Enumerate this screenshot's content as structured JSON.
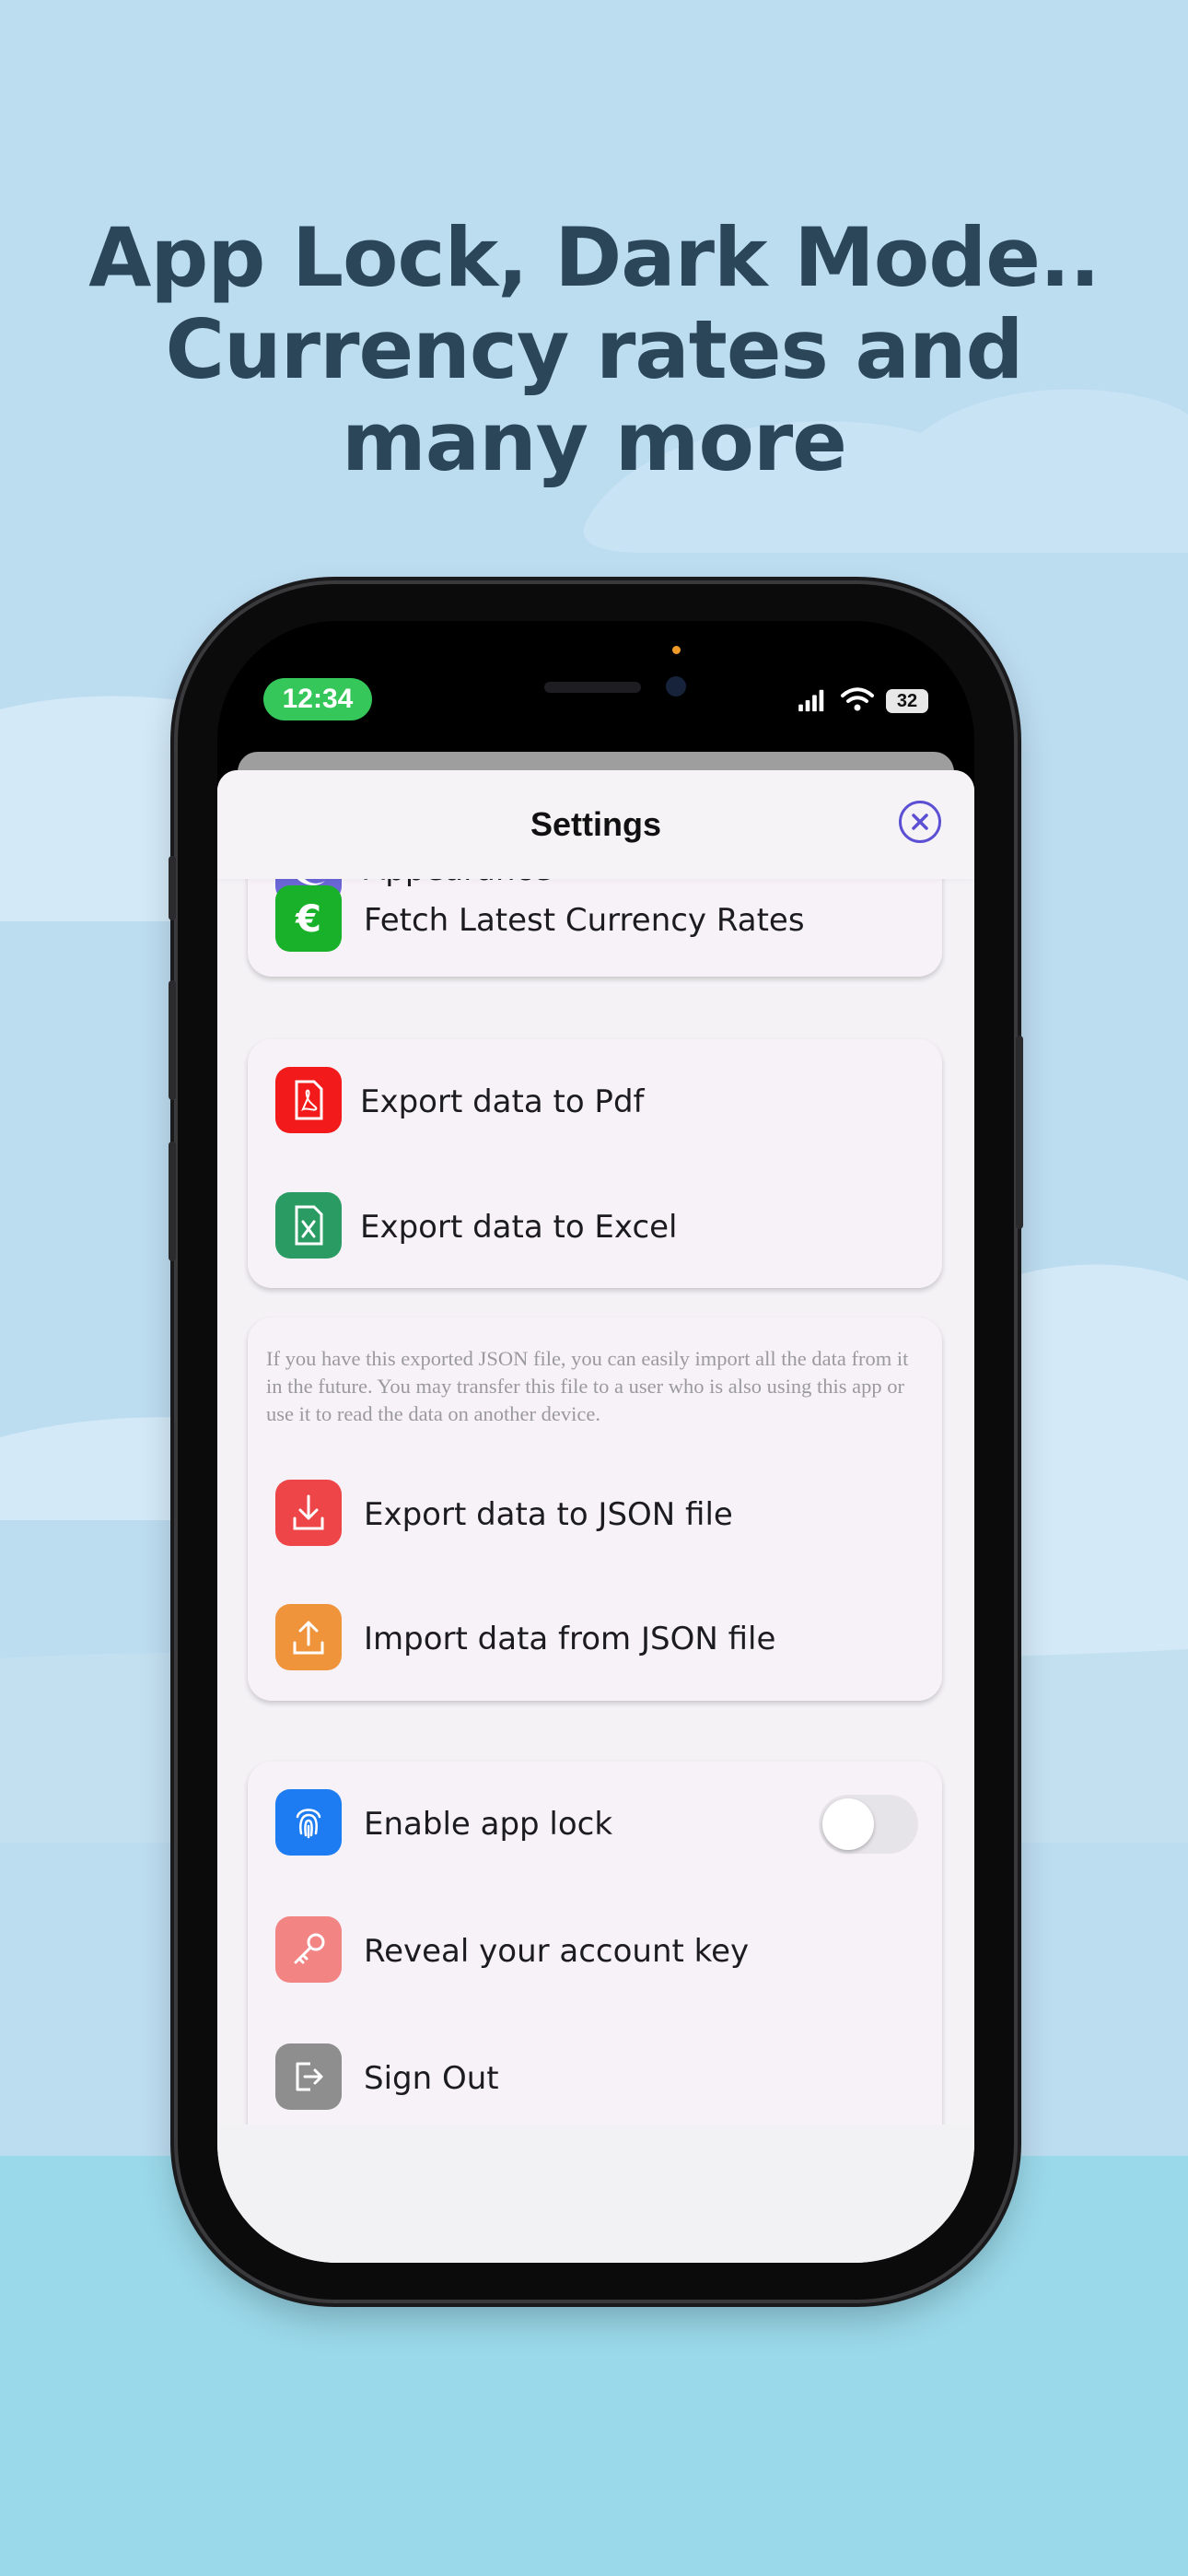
{
  "headline": [
    "App Lock, Dark Mode..",
    "Currency rates and",
    "many more"
  ],
  "status_bar": {
    "time": "12:34",
    "battery": "32"
  },
  "settings": {
    "title": "Settings",
    "appearance_label": "Appearance",
    "currency_label": "Fetch Latest Currency Rates",
    "export_pdf_label": "Export data to Pdf",
    "export_excel_label": "Export data to Excel",
    "json_note": "If you have this exported JSON file, you can easily import all the data from it in the future. You may transfer this file to a user who is also using this app or use it to read the data on another device.",
    "export_json_label": "Export data to JSON file",
    "import_json_label": "Import data from JSON file",
    "app_lock_label": "Enable app lock",
    "app_lock_enabled": false,
    "account_key_label": "Reveal your account key",
    "sign_out_label": "Sign Out"
  },
  "colors": {
    "background": "#bcdcf0",
    "headline": "#2a4658",
    "appearance_icon": "#6a66d6",
    "currency_icon": "#19b12a",
    "pdf_icon": "#f21a1a",
    "excel_icon": "#2a9b62",
    "export_json_icon": "#ee4648",
    "import_json_icon": "#f0943c",
    "app_lock_icon": "#1e7cf2",
    "account_key_icon": "#f28484",
    "sign_out_icon": "#8e8e8e",
    "close_button": "#5b4fd3"
  },
  "icons": {
    "appearance": "moon-icon",
    "currency": "euro-icon",
    "pdf": "pdf-file-icon",
    "excel": "excel-file-icon",
    "export_json": "download-icon",
    "import_json": "upload-icon",
    "app_lock": "fingerprint-icon",
    "account_key": "key-icon",
    "sign_out": "sign-out-icon",
    "close": "close-icon"
  }
}
